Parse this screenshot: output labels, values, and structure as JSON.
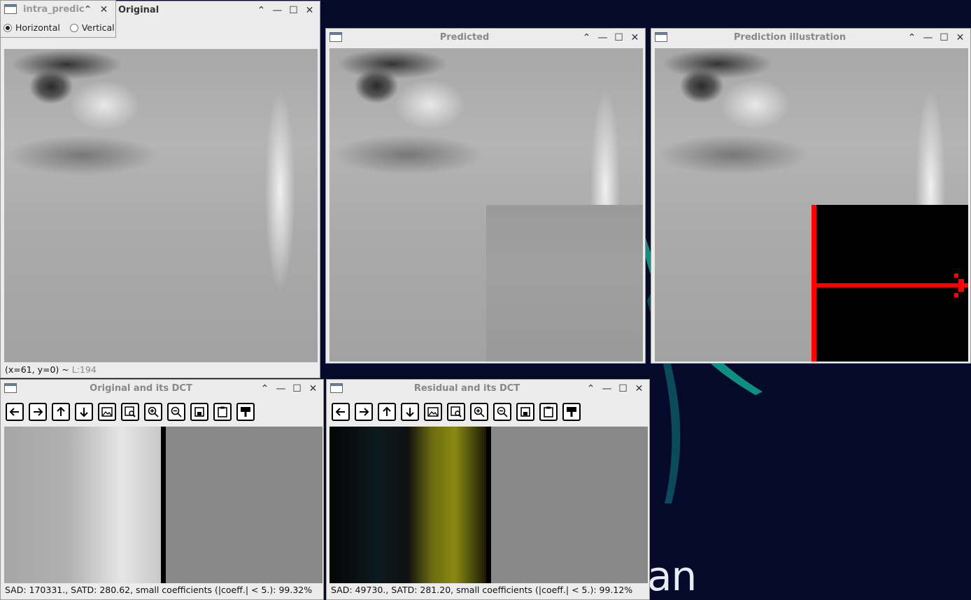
{
  "popup": {
    "title": "intra_predic",
    "radio_horizontal": "Horizontal",
    "radio_vertical": "Vertical",
    "selected": "Horizontal"
  },
  "win_original": {
    "title": "Original",
    "status_coords": "(x=61, y=0) ~",
    "status_level": "L:194"
  },
  "win_predicted": {
    "title": "Predicted"
  },
  "win_illustration": {
    "title": "Prediction illustration"
  },
  "win_original_dct": {
    "title": "Original and its DCT",
    "status": "SAD: 170331., SATD: 280.62, small coefficients (|coeff.| < 5.): 99.32%"
  },
  "win_residual_dct": {
    "title": "Residual and its DCT",
    "status": "SAD: 49730., SATD: 281.20, small coefficients (|coeff.| < 5.): 99.12%"
  },
  "wallpaper": {
    "text": "an"
  },
  "colors": {
    "prediction_line": "#ff0000",
    "wallpaper_bg": "#060a2a"
  },
  "toolbar_icons": [
    "arrow-left-icon",
    "arrow-right-icon",
    "arrow-up-icon",
    "arrow-down-icon",
    "image-icon",
    "zoom-fit-icon",
    "zoom-in-icon",
    "zoom-out-icon",
    "save-icon",
    "clipboard-icon",
    "paint-icon"
  ]
}
